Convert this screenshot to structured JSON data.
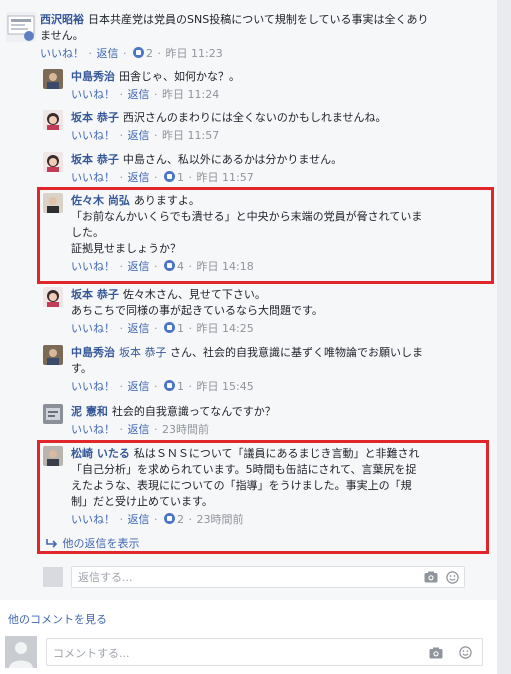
{
  "comments": {
    "c1": {
      "name": "西沢昭裕",
      "lines": [
        "日本共産党は党員のSNS投稿について規制をしている事実は全くあり",
        "ません。"
      ],
      "like": "いいね！",
      "reply": "返信",
      "likes": "2",
      "time": "昨日 11:23"
    },
    "c2": {
      "name": "中島秀治",
      "text": "田舎じゃ、如何かな？。",
      "like": "いいね！",
      "reply": "返信",
      "time": "昨日 11:24"
    },
    "c3": {
      "name": "坂本 恭子",
      "text": "西沢さんのまわりには全くないのかもしれませんね。",
      "like": "いいね！",
      "reply": "返信",
      "time": "昨日 11:57"
    },
    "c4": {
      "name": "坂本 恭子",
      "text": "中島さん、私以外にあるかは分かりません。",
      "like": "いいね！",
      "reply": "返信",
      "likes": "1",
      "time": "昨日 11:57"
    },
    "c5": {
      "name": "佐々木 尚弘",
      "lines": [
        "ありますよ。",
        "「お前なんかいくらでも潰せる」と中央から末端の党員が脅されていま",
        "した。",
        "証拠見せましょうか？"
      ],
      "like": "いいね！",
      "reply": "返信",
      "likes": "4",
      "time": "昨日 14:18"
    },
    "c6": {
      "name": "坂本 恭子",
      "lines": [
        "佐々木さん、見せて下さい。",
        "あちこちで同様の事が起きているなら大問題です。"
      ],
      "like": "いいね！",
      "reply": "返信",
      "likes": "1",
      "time": "昨日 14:25"
    },
    "c7": {
      "name": "中島秀治",
      "mention": "坂本 恭子",
      "lines": [
        "さん、社会的自我意識に基ずく唯物論でお願いしま",
        "す。"
      ],
      "like": "いいね！",
      "reply": "返信",
      "likes": "1",
      "time": "昨日 15:45"
    },
    "c8": {
      "name": "泥 憲和",
      "text": "社会的自我意識ってなんですか？",
      "like": "いいね！",
      "reply": "返信",
      "time": "23時間前"
    },
    "c9": {
      "name": "松崎 いたる",
      "lines": [
        "私はＳＮＳについて「議員にあるまじき言動」と非難され",
        "「自己分析」を求められています。5時間も缶詰にされて、言葉尻を捉",
        "えたような、表現にについての「指導」をうけました。事実上の「規",
        "制」だと受け止めています。"
      ],
      "like": "いいね！",
      "reply": "返信",
      "likes": "2",
      "time": "23時間前"
    }
  },
  "more_replies": "他の返信を表示",
  "reply_placeholder": "返信する...",
  "more_comments": "他のコメントを見る",
  "comment_placeholder": "コメントする...",
  "colors": {
    "link": "#365899",
    "highlight": "#e0262b",
    "like": "#4c75c7"
  }
}
